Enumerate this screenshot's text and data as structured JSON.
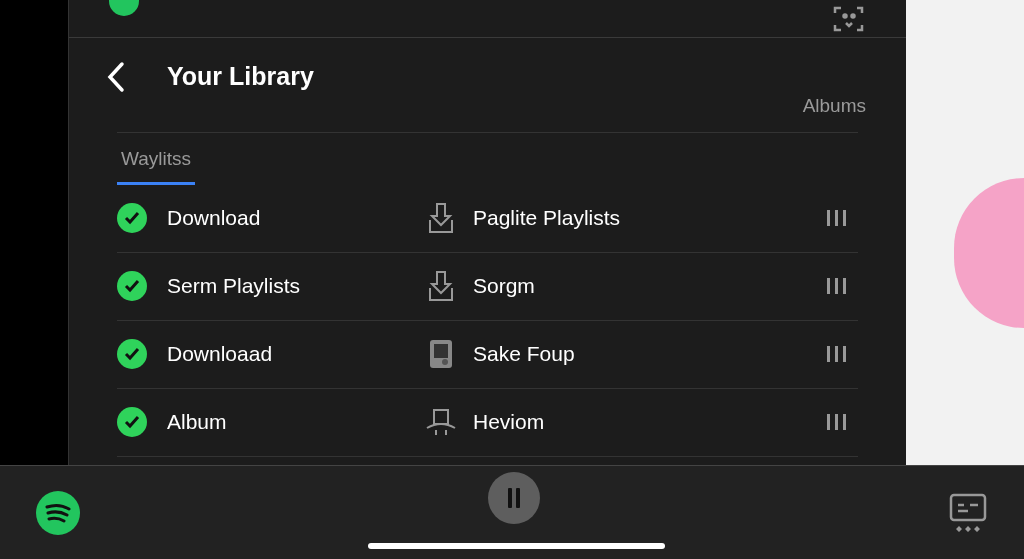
{
  "header": {
    "title": "Your Library"
  },
  "column_header": "Albums",
  "tabs": [
    {
      "label": "Waylitss",
      "selected": true
    }
  ],
  "rows": [
    {
      "left": {
        "label": "Download",
        "checked": true
      },
      "right": {
        "label": "Paglite Playlists",
        "kind": "download"
      }
    },
    {
      "left": {
        "label": "Serm Playlists",
        "checked": true
      },
      "right": {
        "label": "Sorgm",
        "kind": "download"
      }
    },
    {
      "left": {
        "label": "Downloaad",
        "checked": true
      },
      "right": {
        "label": "Sake Foup",
        "kind": "tablet"
      }
    },
    {
      "left": {
        "label": "Album",
        "checked": true
      },
      "right": {
        "label": "Heviom",
        "kind": "hat"
      }
    }
  ],
  "player": {
    "playing": true
  }
}
